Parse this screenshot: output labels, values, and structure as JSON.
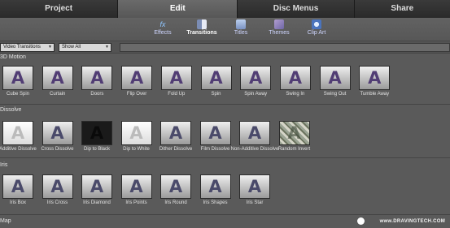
{
  "tabs": {
    "project": "Project",
    "edit": "Edit",
    "disc": "Disc Menus",
    "share": "Share"
  },
  "tools": {
    "effects": "Effects",
    "transitions": "Transitions",
    "titles": "Titles",
    "themes": "Themes",
    "clipart": "Clip Art"
  },
  "filters": {
    "category": "Video Transitions",
    "show": "Show All"
  },
  "categories": {
    "motion": "3D Motion",
    "dissolve": "Dissolve",
    "iris": "Iris",
    "map": "Map"
  },
  "motion": [
    "Cube Spin",
    "Curtain",
    "Doors",
    "Flip Over",
    "Fold Up",
    "Spin",
    "Spin Away",
    "Swing In",
    "Swing Out",
    "Tumble Away"
  ],
  "dissolve": [
    "Additive Dissolve",
    "Cross Dissolve",
    "Dip to Black",
    "Dip to White",
    "Dither Dissolve",
    "Film Dissolve",
    "Non-Additive Dissolve",
    "Random Invert"
  ],
  "iris": [
    "Iris Box",
    "Iris Cross",
    "Iris Diamond",
    "Iris Points",
    "Iris Round",
    "Iris Shapes",
    "Iris Star"
  ],
  "watermark": "www.DRAVINGTECH.COM"
}
